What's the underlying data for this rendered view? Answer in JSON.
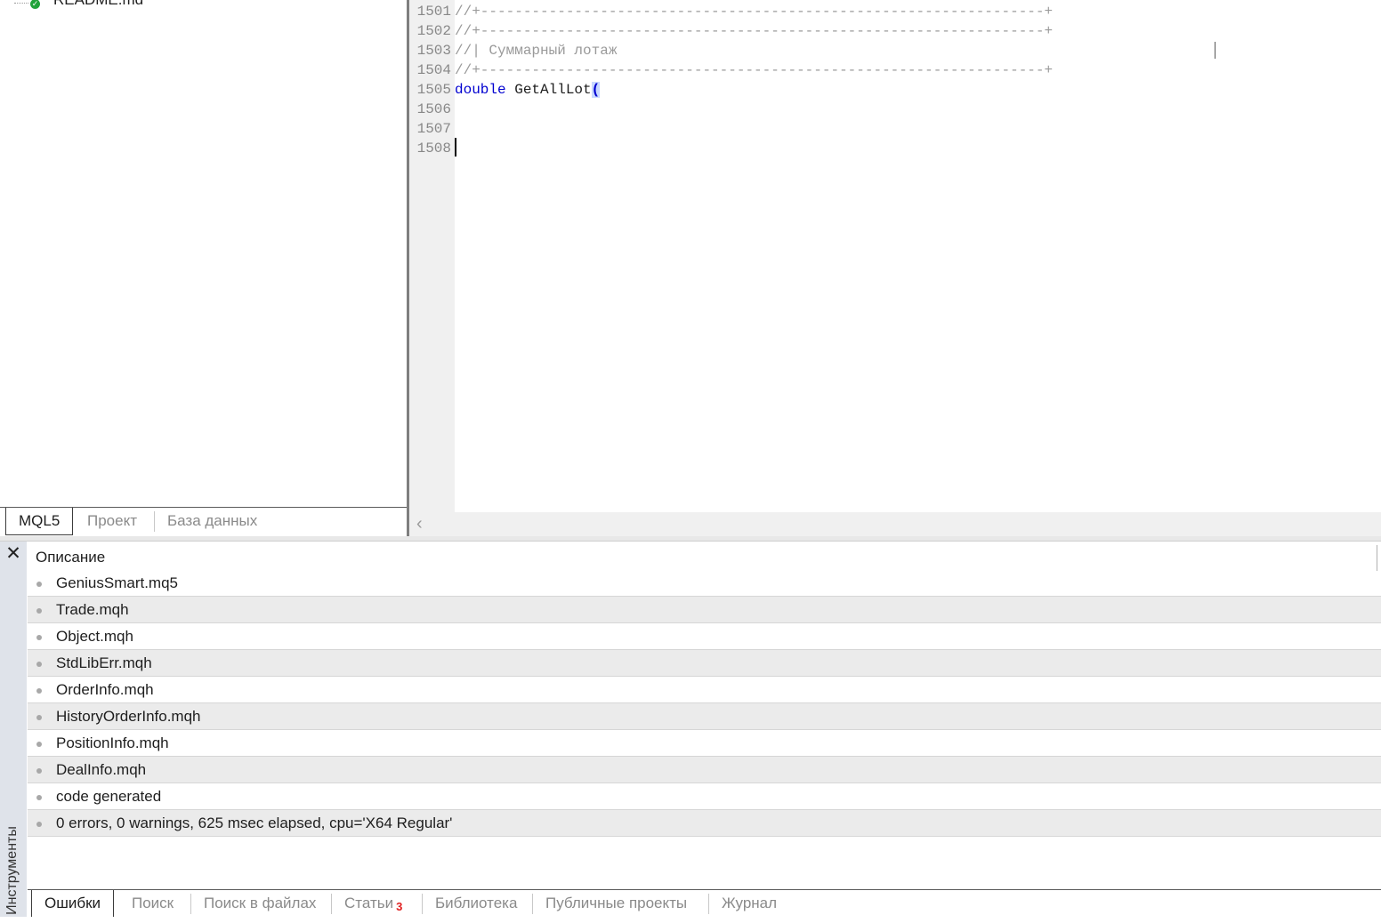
{
  "navigator": {
    "tree_item": {
      "name": "README.md",
      "icon": "markdown-file-icon",
      "status_icon": "green-check-icon"
    },
    "tabs": [
      {
        "label": "MQL5",
        "active": true
      },
      {
        "label": "Проект",
        "active": false
      },
      {
        "label": "База данных",
        "active": false
      }
    ]
  },
  "editor": {
    "lines": [
      {
        "number": "1501",
        "text": "//+------------------------------------------------------------------+"
      },
      {
        "number": "1502",
        "text": "//+------------------------------------------------------------------+"
      },
      {
        "number": "1503",
        "text": "//| Суммарный лотаж"
      },
      {
        "number": "1504",
        "text": "//+------------------------------------------------------------------+"
      },
      {
        "number": "1505",
        "keyword": "double",
        "func": " GetAllLot",
        "paren": "("
      },
      {
        "number": "1506",
        "text": ""
      },
      {
        "number": "1507",
        "text": ""
      },
      {
        "number": "1508",
        "text": ""
      }
    ],
    "scroll_left_icon": "chevron-left-icon"
  },
  "toolbox": {
    "title": "Инструменты",
    "close_icon": "close-icon",
    "column_header": "Описание",
    "rows": [
      "GeniusSmart.mq5",
      "Trade.mqh",
      "Object.mqh",
      "StdLibErr.mqh",
      "OrderInfo.mqh",
      "HistoryOrderInfo.mqh",
      "PositionInfo.mqh",
      "DealInfo.mqh",
      "code generated",
      "0 errors, 0 warnings, 625 msec elapsed, cpu='X64 Regular'"
    ],
    "tabs": [
      {
        "label": "Ошибки",
        "active": true
      },
      {
        "label": "Поиск"
      },
      {
        "label": "Поиск в файлах"
      },
      {
        "label": "Статьи",
        "badge": "3"
      },
      {
        "label": "Библиотека"
      },
      {
        "label": "Публичные проекты"
      },
      {
        "label": "Журнал"
      }
    ]
  },
  "colors": {
    "keyword": "#0000d0",
    "comment": "#9a9a9a",
    "badge": "#e02020",
    "status_ok": "#22a33b"
  }
}
